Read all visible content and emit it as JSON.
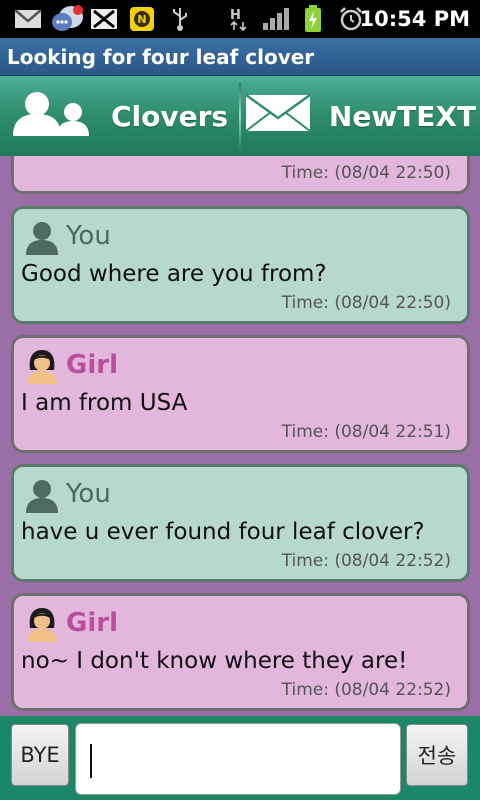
{
  "status": {
    "time": "10:54 PM"
  },
  "app": {
    "title": "Looking for four leaf clover"
  },
  "tabs": [
    {
      "label": "Clovers",
      "icon": "people-icon"
    },
    {
      "label": "NewTEXT",
      "icon": "envelope-icon"
    }
  ],
  "messages": [
    {
      "sender": "",
      "text": "",
      "time": "Time: (08/04 22:50)",
      "role": "girl"
    },
    {
      "sender": "You",
      "text": "Good where are you from?",
      "time": "Time: (08/04 22:50)",
      "role": "you"
    },
    {
      "sender": "Girl",
      "text": "I am from USA",
      "time": "Time: (08/04 22:51)",
      "role": "girl"
    },
    {
      "sender": "You",
      "text": "have u ever found four leaf clover?",
      "time": "Time: (08/04 22:52)",
      "role": "you"
    },
    {
      "sender": "Girl",
      "text": "no~ I don't know where they are!",
      "time": "Time: (08/04 22:52)",
      "role": "girl"
    }
  ],
  "bottom": {
    "bye_label": "BYE",
    "send_label": "전송",
    "input_value": ""
  },
  "colors": {
    "girl_bubble": "#e3b6dc",
    "you_bubble": "#b7d9cd",
    "chat_bg": "#9a6fa8",
    "tab_green": "#2f8b6e"
  }
}
